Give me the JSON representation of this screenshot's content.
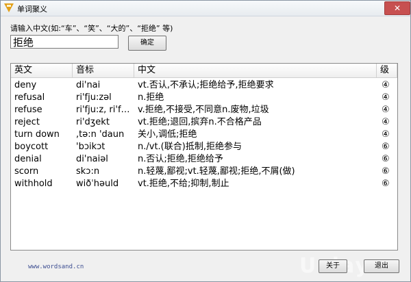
{
  "window": {
    "title": "单词聚义"
  },
  "search": {
    "prompt": "请输入中文(如:“车”、“笑”、“大的”、“拒绝” 等)",
    "value": "拒绝",
    "ok_label": "确定"
  },
  "table": {
    "headers": [
      "英文",
      "音标",
      "中文",
      "级"
    ],
    "rows": [
      {
        "en": "deny",
        "ph": "di'nai",
        "cn": "vt.否认,不承认;拒绝给予,拒绝要求",
        "lv": "④"
      },
      {
        "en": "refusal",
        "ph": "ri'fju:zəl",
        "cn": "n.拒绝",
        "lv": "④"
      },
      {
        "en": "refuse",
        "ph": "ri'fju:z, ri'f…",
        "cn": "v.拒绝,不接受,不同意n.废物,垃圾",
        "lv": "④"
      },
      {
        "en": "reject",
        "ph": "ri'dʒekt",
        "cn": "vt.拒绝;退回,摈弃n.不合格产品",
        "lv": "④"
      },
      {
        "en": "turn down",
        "ph": ",tə:n 'daun",
        "cn": "关小,调低;拒绝",
        "lv": "④"
      },
      {
        "en": "boycott",
        "ph": "'bɔikɔt",
        "cn": "n./vt.(联合)抵制,拒绝参与",
        "lv": "⑥"
      },
      {
        "en": "denial",
        "ph": "di'naiəl",
        "cn": "n.否认;拒绝,拒绝给予",
        "lv": "⑥"
      },
      {
        "en": "scorn",
        "ph": "skɔ:n",
        "cn": "n.轻蔑,鄙视;vt.轻蔑,鄙视;拒绝,不屑(做)",
        "lv": "⑥"
      },
      {
        "en": "withhold",
        "ph": "wiðˈhəuld",
        "cn": "vt.拒绝,不给;抑制,制止",
        "lv": "⑥"
      }
    ]
  },
  "footer": {
    "website": "www.wordsand.cn",
    "close_label": "关于",
    "exit_label": "退出",
    "watermark": "Uxiay"
  },
  "colors": {
    "close_button": "#c75050",
    "app_icon": "#e2a019"
  }
}
